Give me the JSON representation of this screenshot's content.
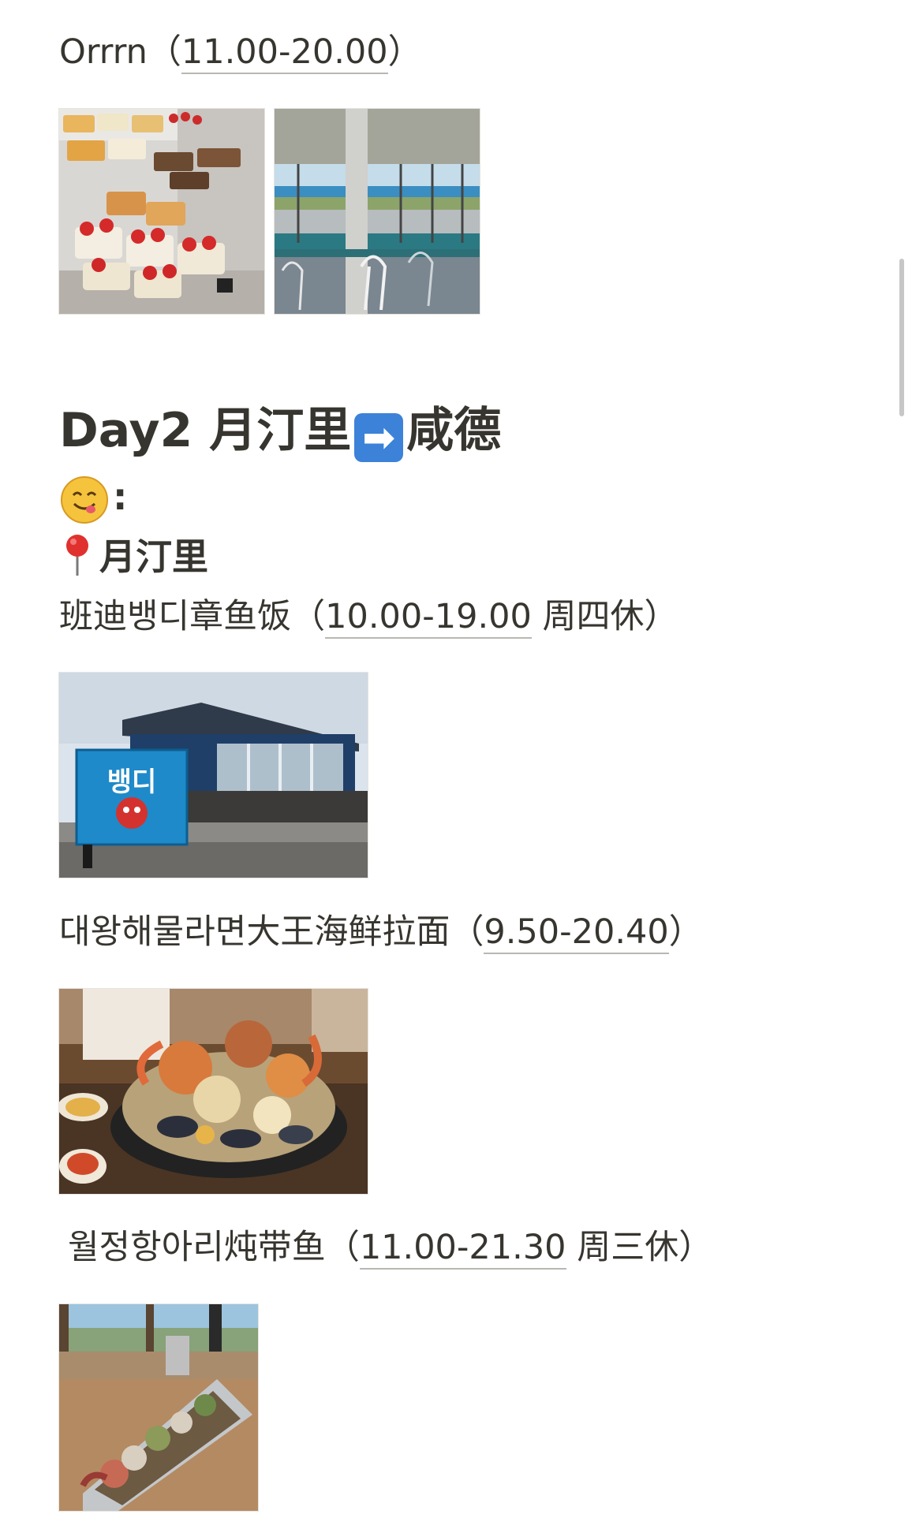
{
  "colors": {
    "text": "#37352f",
    "underline": "#b9b7b2",
    "arrow_blue": "#3c82d8"
  },
  "top_entry": {
    "name": "Orrrn",
    "open_paren": "（",
    "hours": "11.00-20.00",
    "close_paren": "）"
  },
  "day_heading": {
    "prefix": "Day2 月汀里",
    "arrow_icon": "right-arrow-icon",
    "suffix": "咸德"
  },
  "food_label": {
    "icon": "yum-face-icon",
    "colon": ":"
  },
  "location": {
    "icon": "round-pushpin-icon",
    "name": "月汀里"
  },
  "restaurants": [
    {
      "name": "班迪뱅디章鱼饭",
      "open_paren": "（",
      "hours": "10.00-19.00",
      "note": " 周四休",
      "close_paren": "）"
    },
    {
      "name": "대왕해물라면大王海鲜拉面",
      "open_paren": "（",
      "hours": "9.50-20.40",
      "note": "",
      "close_paren": "）"
    },
    {
      "name": "월정항아리炖带鱼",
      "open_paren": "（",
      "hours": "11.00-21.30",
      "note": " 周三休",
      "close_paren": "）"
    }
  ],
  "photos": {
    "orrrn_1": "dessert-display-photo",
    "orrrn_2": "ocean-view-cafe-photo",
    "bbangdi": "bbangdi-restaurant-exterior-photo",
    "bbangdi_sign": "뱅디",
    "seafood_ramen": "seafood-pot-photo",
    "hairtail": "hairtail-stew-photo"
  }
}
